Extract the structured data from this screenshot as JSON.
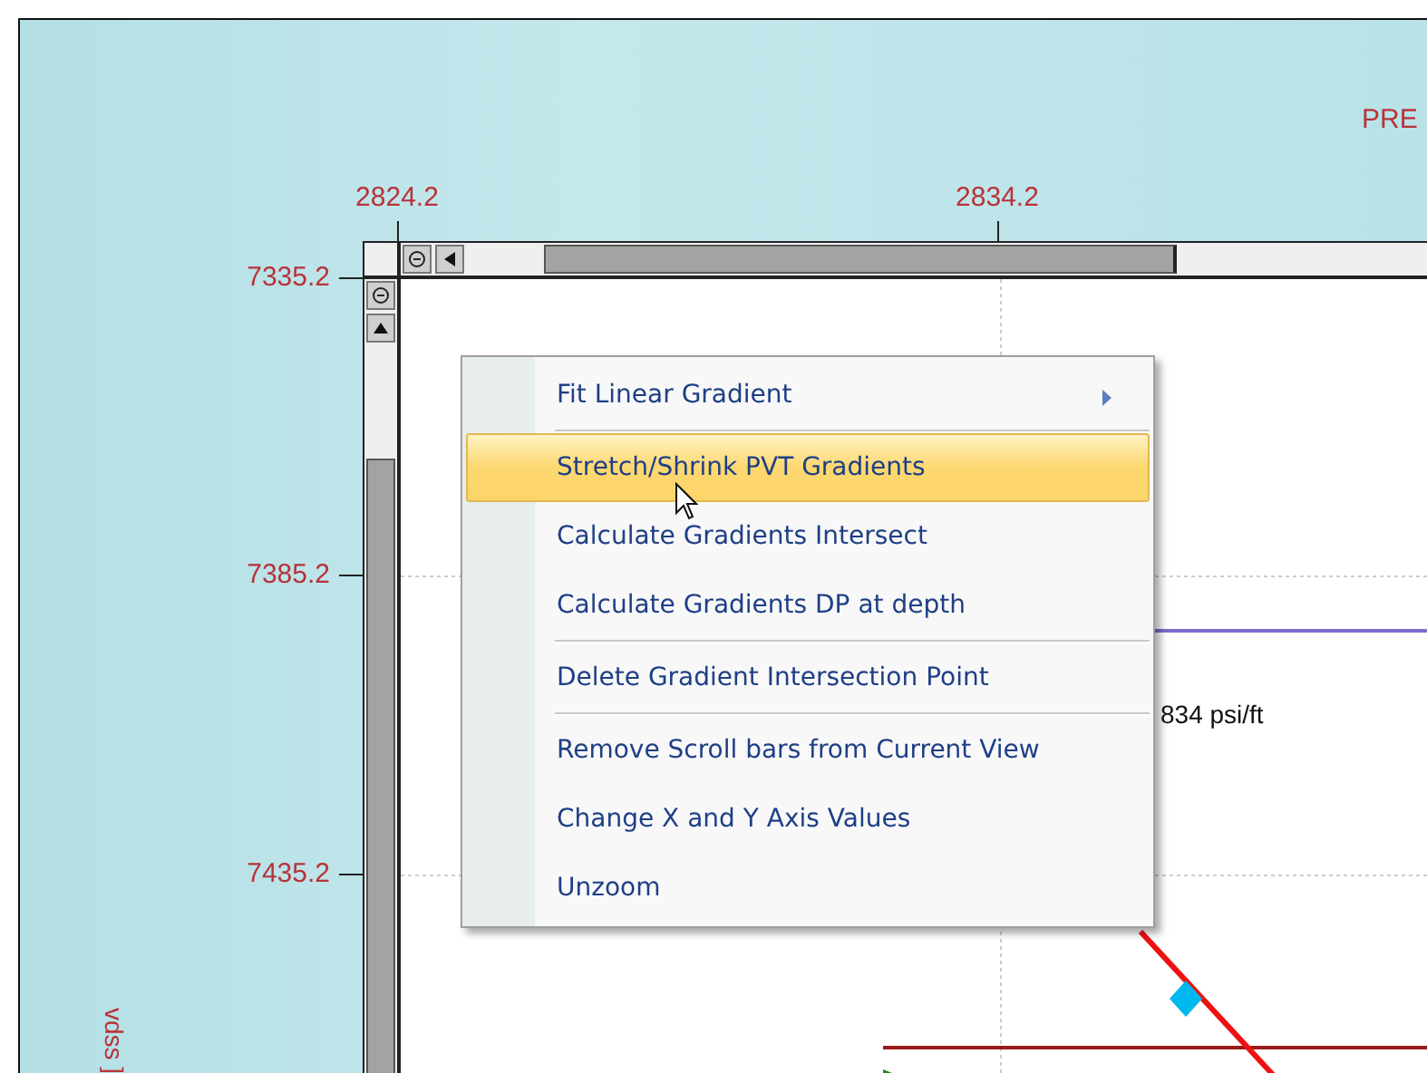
{
  "chart_title_fragment": "PRE",
  "x_ticks": [
    "2824.2",
    "2834.2"
  ],
  "y_ticks": [
    "7335.2",
    "7385.2",
    "7435.2"
  ],
  "y_axis_label_fragment": "vdss ]",
  "gradient_label": "834 psi/ft",
  "context_menu": [
    {
      "kind": "item",
      "label": "Fit Linear Gradient",
      "selected": false,
      "submenu": true
    },
    {
      "kind": "separator"
    },
    {
      "kind": "item",
      "label": "Stretch/Shrink PVT Gradients",
      "selected": true,
      "submenu": false
    },
    {
      "kind": "item",
      "label": "Calculate Gradients Intersect",
      "selected": false,
      "submenu": false
    },
    {
      "kind": "item",
      "label": "Calculate Gradients DP at depth",
      "selected": false,
      "submenu": false
    },
    {
      "kind": "separator"
    },
    {
      "kind": "item",
      "label": "Delete Gradient Intersection Point",
      "selected": false,
      "submenu": false
    },
    {
      "kind": "separator"
    },
    {
      "kind": "item",
      "label": "Remove Scroll bars from Current View",
      "selected": false,
      "submenu": false
    },
    {
      "kind": "item",
      "label": "Change X and Y Axis Values",
      "selected": false,
      "submenu": false
    },
    {
      "kind": "item",
      "label": "Unzoom",
      "selected": false,
      "submenu": false
    }
  ]
}
